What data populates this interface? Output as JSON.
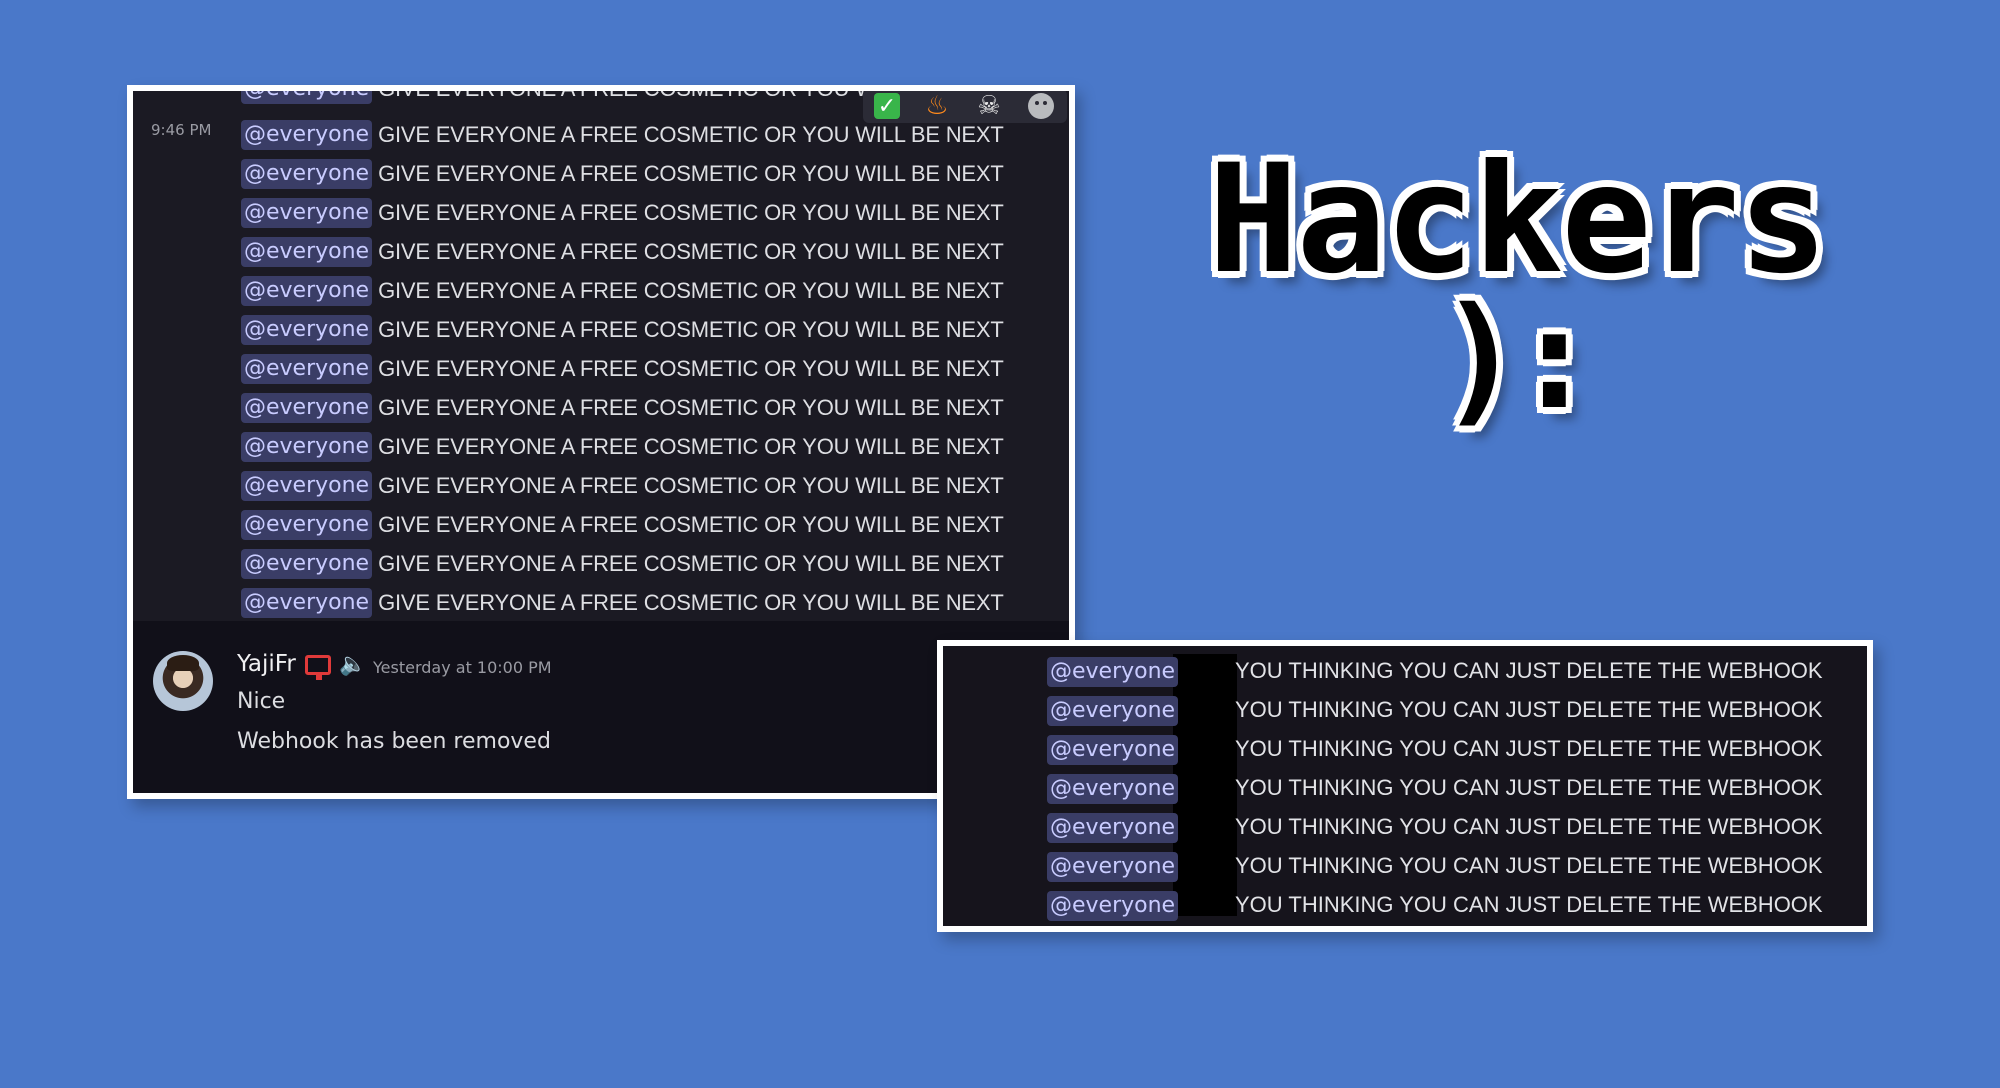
{
  "panel1": {
    "timestamp": "9:46 PM",
    "partial_first_line": "GIVE EVERYONE A FREE COSMETIC OR YOU WIL",
    "mention": "@everyone",
    "spam_text": "GIVE EVERYONE A FREE COSMETIC OR YOU WILL BE NEXT",
    "reactions": [
      "check-mark-emoji",
      "fire-emoji",
      "skull-emoji",
      "add-reaction-icon"
    ],
    "message": {
      "username": "YajiFr",
      "time": "Yesterday at 10:00 PM",
      "lines": [
        "Nice",
        "Webhook has been removed"
      ]
    }
  },
  "title": {
    "word": "Hackers",
    "emoticon": "):"
  },
  "panel2": {
    "mention": "@everyone",
    "text": "YOU THINKING YOU CAN JUST DELETE THE WEBHOOK"
  }
}
